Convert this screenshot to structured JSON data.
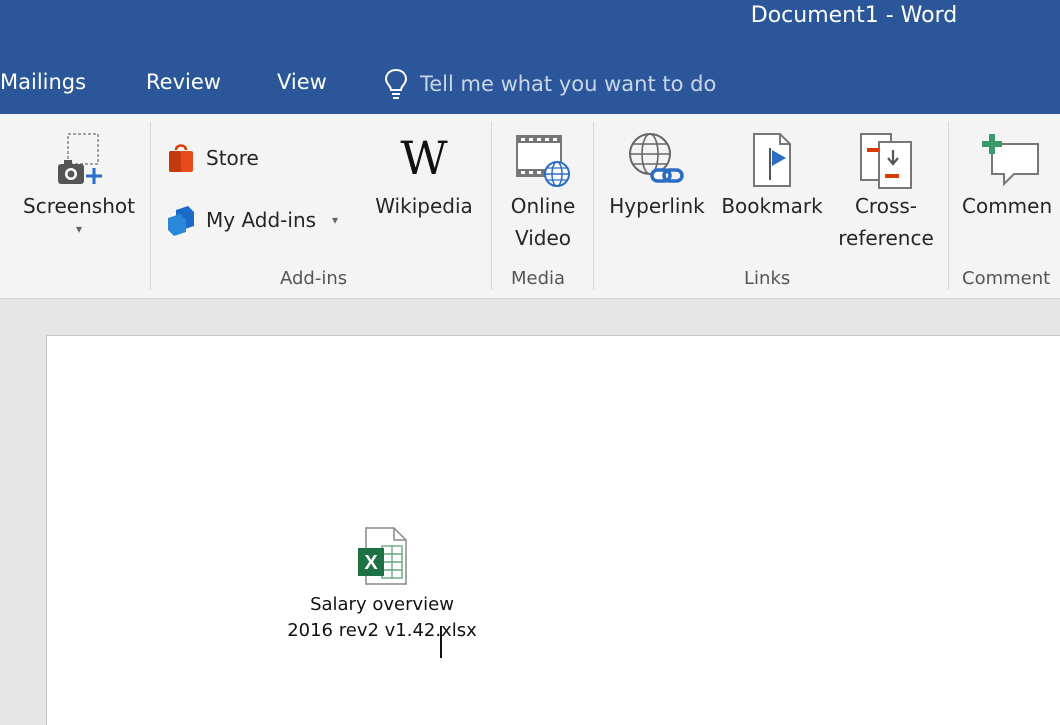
{
  "window": {
    "title": "Document1 - Word"
  },
  "tabs": [
    "Mailings",
    "Review",
    "View"
  ],
  "tell_me": {
    "placeholder": "Tell me what you want to do"
  },
  "ribbon": {
    "screenshot": {
      "label": "Screenshot",
      "dropdown": "▾"
    },
    "addins": {
      "store_label": "Store",
      "my_addins_label": "My Add-ins",
      "wikipedia_label": "Wikipedia",
      "group_label": "Add-ins"
    },
    "media": {
      "online_video_label_1": "Online",
      "online_video_label_2": "Video",
      "group_label": "Media"
    },
    "links": {
      "hyperlink_label": "Hyperlink",
      "bookmark_label": "Bookmark",
      "crossref_label_1": "Cross-",
      "crossref_label_2": "reference",
      "group_label": "Links"
    },
    "comments": {
      "comment_label": "Commen",
      "group_label": "Comment"
    }
  },
  "document": {
    "attachment": {
      "line1": "Salary overview",
      "line2": "2016 rev2 v1.42.xlsx",
      "icon": "excel-file-icon"
    }
  },
  "colors": {
    "title_bar": "#2b579a",
    "ribbon": "#f4f4f4",
    "excel_green": "#1e7145"
  }
}
